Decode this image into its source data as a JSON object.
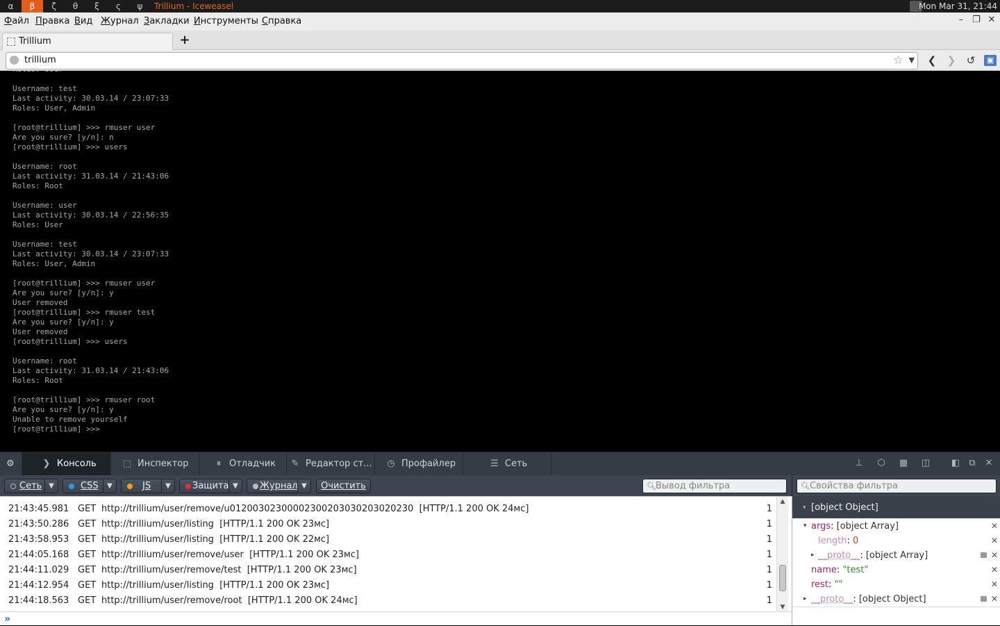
{
  "system_bar": {
    "workspaces": [
      "α",
      "β",
      "ζ",
      "θ",
      "ξ",
      "ς",
      "ψ"
    ],
    "active_workspace": "β",
    "window_title": "Trillium - Iceweasel",
    "clock": "Mon Mar 31, 21:44"
  },
  "menu": {
    "items": [
      "Файл",
      "Правка",
      "Вид",
      "Журнал",
      "Закладки",
      "Инструменты",
      "Справка"
    ]
  },
  "tab": {
    "title": "Trillium",
    "new_tab": "+"
  },
  "nav": {
    "url": "trillium"
  },
  "terminal": {
    "lines": [
      "Roles: User",
      "",
      "Username: test",
      "Last activity: 30.03.14 / 23:07:33",
      "Roles: User, Admin",
      "",
      "[root@trillium] >>> rmuser user",
      "Are you sure? [y/n]: n",
      "[root@trillium] >>> users",
      "",
      "Username: root",
      "Last activity: 31.03.14 / 21:43:06",
      "Roles: Root",
      "",
      "Username: user",
      "Last activity: 30.03.14 / 22:56:35",
      "Roles: User",
      "",
      "Username: test",
      "Last activity: 30.03.14 / 23:07:33",
      "Roles: User, Admin",
      "",
      "[root@trillium] >>> rmuser user",
      "Are you sure? [y/n]: y",
      "User removed",
      "[root@trillium] >>> rmuser test",
      "Are you sure? [y/n]: y",
      "User removed",
      "[root@trillium] >>> users",
      "",
      "Username: root",
      "Last activity: 31.03.14 / 21:43:06",
      "Roles: Root",
      "",
      "[root@trillium] >>> rmuser root",
      "Are you sure? [y/n]: y",
      "Unable to remove yourself",
      "[root@trillium] >>>"
    ]
  },
  "devtools": {
    "tabs": [
      "Консоль",
      "Инспектор",
      "Отладчик",
      "Редактор ст...",
      "Профайлер",
      "Сеть"
    ],
    "active_tab": "Консоль",
    "filters": {
      "net": "Сеть",
      "css": "CSS",
      "js": "JS",
      "security": "Защита",
      "log": "Журнал",
      "clear": "Очистить",
      "search_placeholder": "Вывод фильтра"
    },
    "log": [
      {
        "time": "21:43:45.981",
        "method": "GET",
        "url": "http://trillium/user/remove/u012003023000023002030302030202 30",
        "status": "[HTTP/1.1 200 OK 24мс]",
        "count": "1"
      },
      {
        "time": "21:43:50.286",
        "method": "GET",
        "url": "http://trillium/user/listing",
        "status": "[HTTP/1.1 200 OK 23мс]",
        "count": "1"
      },
      {
        "time": "21:43:58.953",
        "method": "GET",
        "url": "http://trillium/user/listing",
        "status": "[HTTP/1.1 200 OK 22мс]",
        "count": "1"
      },
      {
        "time": "21:44:05.168",
        "method": "GET",
        "url": "http://trillium/user/remove/user",
        "status": "[HTTP/1.1 200 OK 23мс]",
        "count": "1"
      },
      {
        "time": "21:44:11.029",
        "method": "GET",
        "url": "http://trillium/user/remove/test",
        "status": "[HTTP/1.1 200 OK 23мс]",
        "count": "1"
      },
      {
        "time": "21:44:12.954",
        "method": "GET",
        "url": "http://trillium/user/listing",
        "status": "[HTTP/1.1 200 OK 23мс]",
        "count": "1"
      },
      {
        "time": "21:44:18.563",
        "method": "GET",
        "url": "http://trillium/user/remove/root",
        "status": "[HTTP/1.1 200 OK 24мс]",
        "count": "1"
      }
    ],
    "variables": {
      "filter_placeholder": "Свойства фильтра",
      "header": "[object Object]",
      "rows": [
        {
          "key": "args",
          "value": "[object Array]"
        },
        {
          "key": "length",
          "value": "0"
        },
        {
          "key": "__proto__",
          "value": "[object Array]"
        },
        {
          "key": "name",
          "value": "\"test\""
        },
        {
          "key": "rest",
          "value": "\"\""
        },
        {
          "key": "__proto__",
          "value": "[object Object]"
        }
      ]
    }
  },
  "colors": {
    "accent_orange": "#e05d1a",
    "devtools_dark": "#343c45",
    "terminal_text": "#a8a8a8"
  }
}
